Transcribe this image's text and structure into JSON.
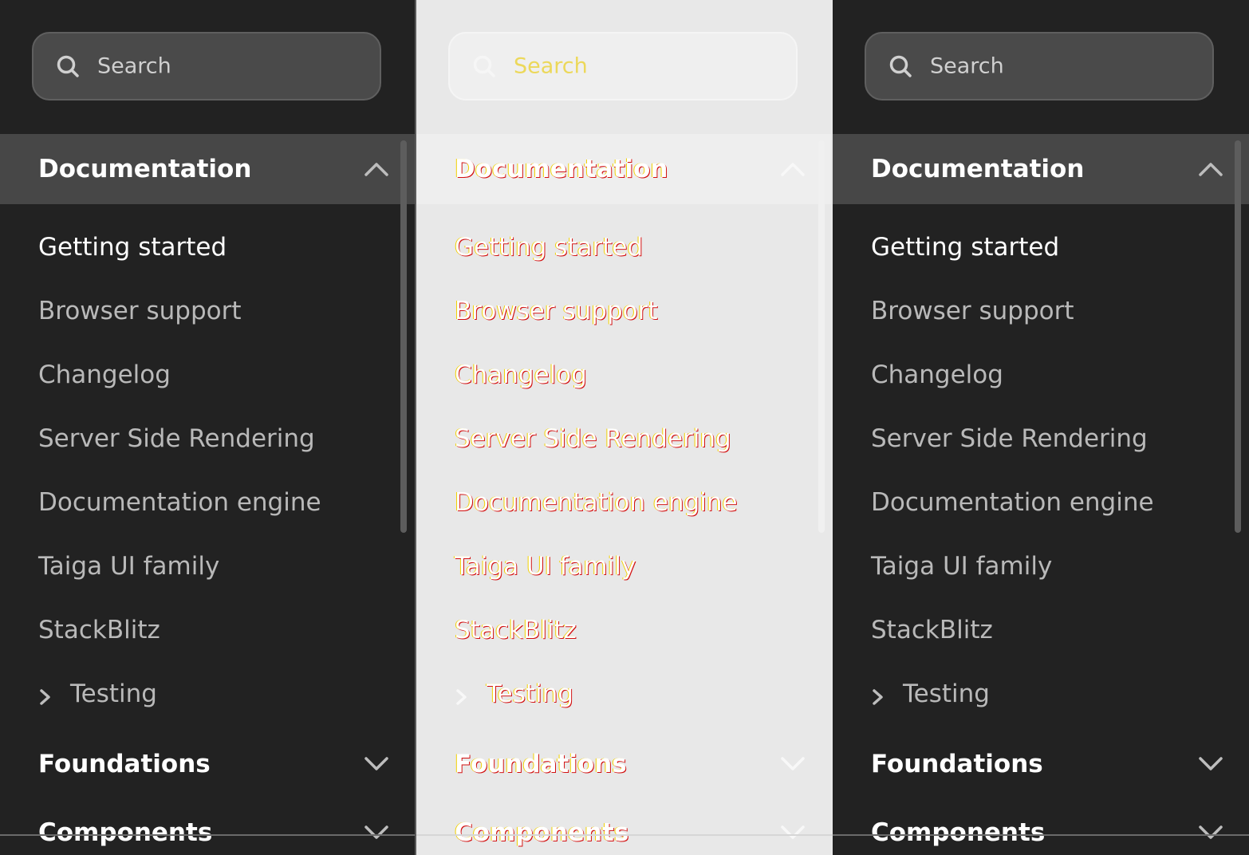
{
  "search": {
    "placeholder": "Search"
  },
  "sections": {
    "documentation": {
      "title": "Documentation"
    },
    "foundations": {
      "title": "Foundations"
    },
    "components": {
      "title": "Components"
    }
  },
  "nav": {
    "getting_started": "Getting started",
    "browser_support": "Browser support",
    "changelog": "Changelog",
    "ssr": "Server Side Rendering",
    "doc_engine": "Documentation engine",
    "taiga_family": "Taiga UI family",
    "stackblitz": "StackBlitz",
    "testing": "Testing"
  },
  "icons": {
    "search": "search-icon",
    "collapse": "chevron-up-icon",
    "expand": "chevron-down-icon",
    "submenu": "chevron-right-icon"
  },
  "colors": {
    "dark_bg": "#222222",
    "dark_header": "#474747",
    "light_bg": "#e8e8e8",
    "text_active": "#ffffff",
    "text_muted": "#b9b9b9"
  }
}
